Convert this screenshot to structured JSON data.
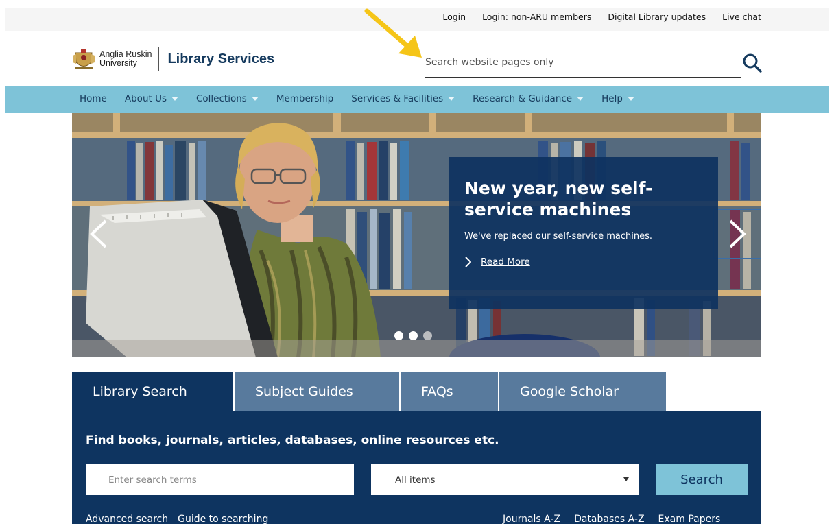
{
  "topbar": {
    "links": [
      "Login",
      "Login: non-ARU members",
      "Digital Library updates",
      "Live chat"
    ]
  },
  "header": {
    "university": [
      "Anglia Ruskin",
      "University"
    ],
    "title": "Library Services",
    "search_placeholder": "Search website pages only"
  },
  "nav": {
    "items": [
      {
        "label": "Home",
        "dropdown": false
      },
      {
        "label": "About Us",
        "dropdown": true
      },
      {
        "label": "Collections",
        "dropdown": true
      },
      {
        "label": "Membership",
        "dropdown": false
      },
      {
        "label": "Services & Facilities",
        "dropdown": true
      },
      {
        "label": "Research & Guidance",
        "dropdown": true
      },
      {
        "label": "Help",
        "dropdown": true
      }
    ]
  },
  "hero": {
    "headline": "New year, new self-service machines",
    "text": "We've replaced our self-service machines.",
    "read_more": "Read More",
    "slides": 3
  },
  "tabs": [
    "Library Search",
    "Subject Guides",
    "FAQs",
    "Google Scholar"
  ],
  "panel": {
    "heading": "Find books, journals, articles, databases, online resources etc.",
    "search_placeholder": "Enter search terms",
    "select_value": "All items",
    "search_button": "Search",
    "links_left": [
      "Advanced search",
      "Guide to searching"
    ],
    "links_right": [
      "Journals A-Z",
      "Databases A-Z",
      "Exam Papers"
    ]
  },
  "colors": {
    "navy": "#0e3460",
    "nav_blue": "#7ec3d8",
    "tab_inactive": "#587a9d",
    "arrow": "#f5c518"
  }
}
